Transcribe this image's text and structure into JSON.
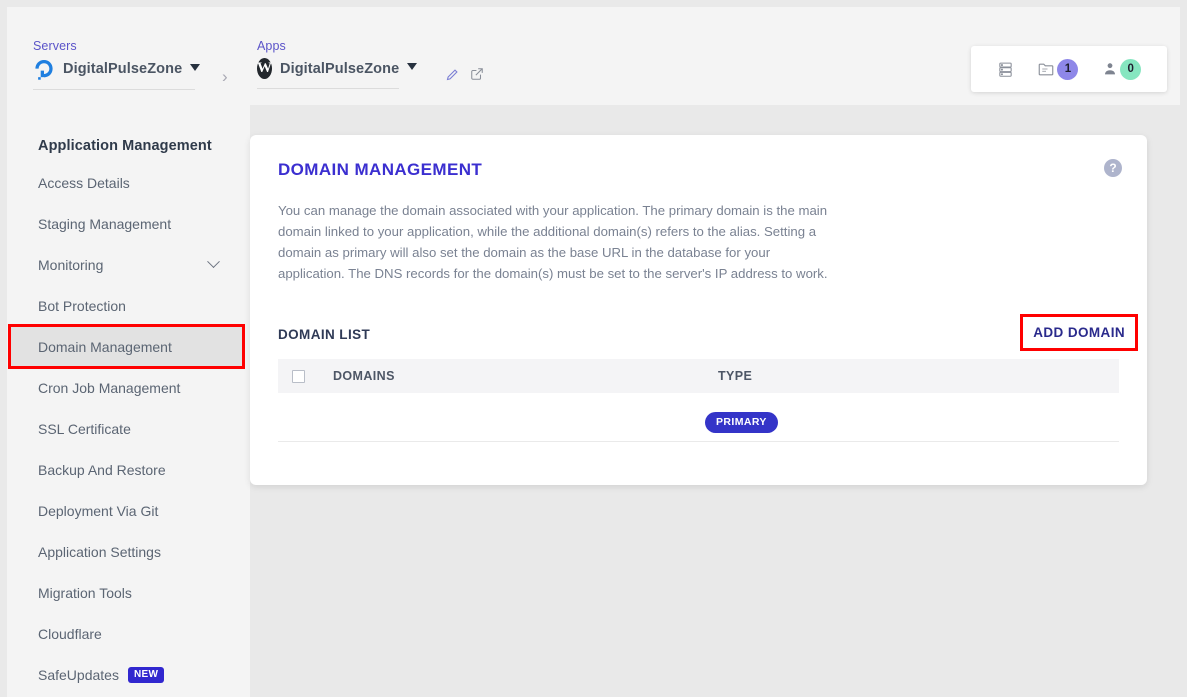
{
  "topbar": {
    "servers": {
      "label": "Servers",
      "name": "DigitalPulseZone",
      "logo_icon": "digitalocean-logo-icon",
      "caret_icon": "caret-down-icon"
    },
    "separator_icon": "chevron-right-icon",
    "apps": {
      "label": "Apps",
      "name": "DigitalPulseZone",
      "logo_icon": "wordpress-logo-icon",
      "logo_glyph": "W",
      "caret_icon": "caret-down-icon",
      "edit_icon": "pencil-icon",
      "open_icon": "external-link-icon"
    },
    "stats": [
      {
        "icon": "server-stack-icon",
        "count": "",
        "badge_color": ""
      },
      {
        "icon": "folder-icon",
        "count": "1",
        "badge_color": "#8e87e8"
      },
      {
        "icon": "user-icon",
        "count": "0",
        "badge_color": "#86e6c0"
      }
    ]
  },
  "sidebar": {
    "title": "Application Management",
    "items": [
      {
        "label": "Access Details",
        "active": false,
        "expandable": false,
        "badge": ""
      },
      {
        "label": "Staging Management",
        "active": false,
        "expandable": false,
        "badge": ""
      },
      {
        "label": "Monitoring",
        "active": false,
        "expandable": true,
        "badge": ""
      },
      {
        "label": "Bot Protection",
        "active": false,
        "expandable": false,
        "badge": ""
      },
      {
        "label": "Domain Management",
        "active": true,
        "expandable": false,
        "badge": ""
      },
      {
        "label": "Cron Job Management",
        "active": false,
        "expandable": false,
        "badge": ""
      },
      {
        "label": "SSL Certificate",
        "active": false,
        "expandable": false,
        "badge": ""
      },
      {
        "label": "Backup And Restore",
        "active": false,
        "expandable": false,
        "badge": ""
      },
      {
        "label": "Deployment Via Git",
        "active": false,
        "expandable": false,
        "badge": ""
      },
      {
        "label": "Application Settings",
        "active": false,
        "expandable": false,
        "badge": ""
      },
      {
        "label": "Migration Tools",
        "active": false,
        "expandable": false,
        "badge": ""
      },
      {
        "label": "Cloudflare",
        "active": false,
        "expandable": false,
        "badge": ""
      },
      {
        "label": "SafeUpdates",
        "active": false,
        "expandable": false,
        "badge": "NEW"
      }
    ]
  },
  "card": {
    "title": "DOMAIN MANAGEMENT",
    "description": "You can manage the domain associated with your application. The primary domain is the main domain linked to your application, while the additional domain(s) refers to the alias. Setting a domain as primary will also set the domain as the base URL in the database for your application. The DNS records for the domain(s) must be set to the server's IP address to work.",
    "help_icon": "help-circle-icon",
    "help_glyph": "?",
    "list_title": "DOMAIN LIST",
    "add_domain_label": "ADD DOMAIN",
    "table": {
      "columns": [
        "DOMAINS",
        "TYPE"
      ],
      "rows": [
        {
          "domain": "",
          "type": "PRIMARY"
        }
      ]
    }
  },
  "colors": {
    "accent_purple": "#3b2fd0",
    "highlight_red": "#ff0000",
    "primary_badge": "#3434c8",
    "new_badge": "#3127cf"
  }
}
